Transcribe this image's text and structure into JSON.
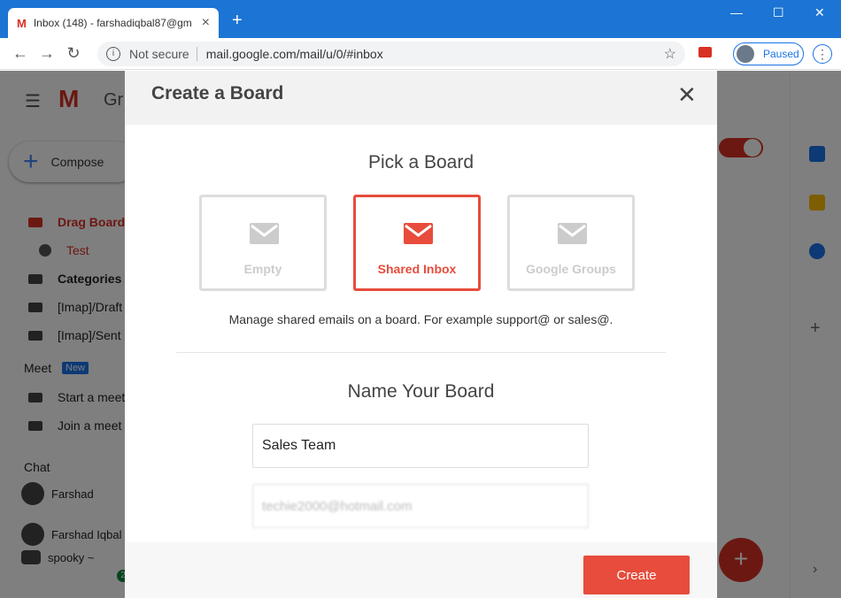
{
  "browser": {
    "tab_title": "Inbox (148) - farshadiqbal87@gm",
    "tab_icon": "gmail-icon",
    "address": {
      "security": "Not secure",
      "url": "mail.google.com/mail/u/0/#inbox"
    },
    "profile_status": "Paused"
  },
  "gmail": {
    "logo_partial": "Gr",
    "compose_label": "Compose",
    "sidebar": [
      {
        "label": "Drag Board",
        "color": "#d93025"
      },
      {
        "label": "Test",
        "color": "#d93025"
      },
      {
        "label": "Categories"
      },
      {
        "label": "[Imap]/Draft"
      },
      {
        "label": "[Imap]/Sent"
      }
    ],
    "meet": {
      "heading": "Meet",
      "badge": "New",
      "items": [
        "Start a meet",
        "Join a meet"
      ]
    },
    "chat": {
      "heading": "Chat",
      "users": [
        "Farshad",
        "Farshad Iqbal",
        "spooky ~"
      ]
    },
    "chat_badge": "2"
  },
  "modal": {
    "title": "Create a Board",
    "pick_heading": "Pick a Board",
    "options": [
      {
        "label": "Empty",
        "selected": false
      },
      {
        "label": "Shared Inbox",
        "selected": true
      },
      {
        "label": "Google Groups",
        "selected": false
      }
    ],
    "description": "Manage shared emails on a board. For example support@ or sales@.",
    "name_heading": "Name Your Board",
    "board_name": "Sales Team",
    "email": "techie2000@hotmail.com",
    "create_label": "Create",
    "accent": "#e74c3c"
  }
}
